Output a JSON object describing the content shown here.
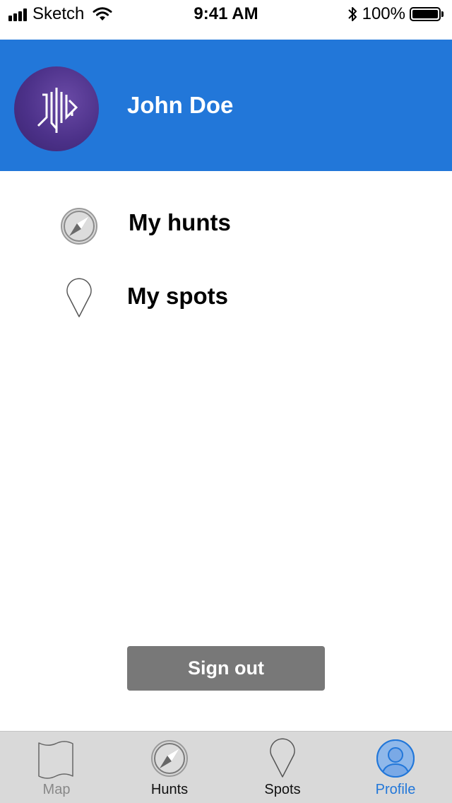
{
  "status_bar": {
    "carrier": "Sketch",
    "time": "9:41 AM",
    "battery": "100%"
  },
  "profile": {
    "name": "John Doe"
  },
  "menu": {
    "items": [
      {
        "label": "My hunts",
        "icon": "compass-icon"
      },
      {
        "label": "My spots",
        "icon": "map-pin-icon"
      }
    ]
  },
  "actions": {
    "sign_out_label": "Sign out"
  },
  "tab_bar": {
    "tabs": [
      {
        "label": "Map",
        "icon": "map-icon"
      },
      {
        "label": "Hunts",
        "icon": "compass-icon"
      },
      {
        "label": "Spots",
        "icon": "map-pin-icon"
      },
      {
        "label": "Profile",
        "icon": "user-icon"
      }
    ],
    "active": "Profile"
  },
  "colors": {
    "header_bg": "#2277d9",
    "accent": "#2277d9",
    "button_bg": "#787878",
    "tab_bar_bg": "#d9d9d9"
  }
}
